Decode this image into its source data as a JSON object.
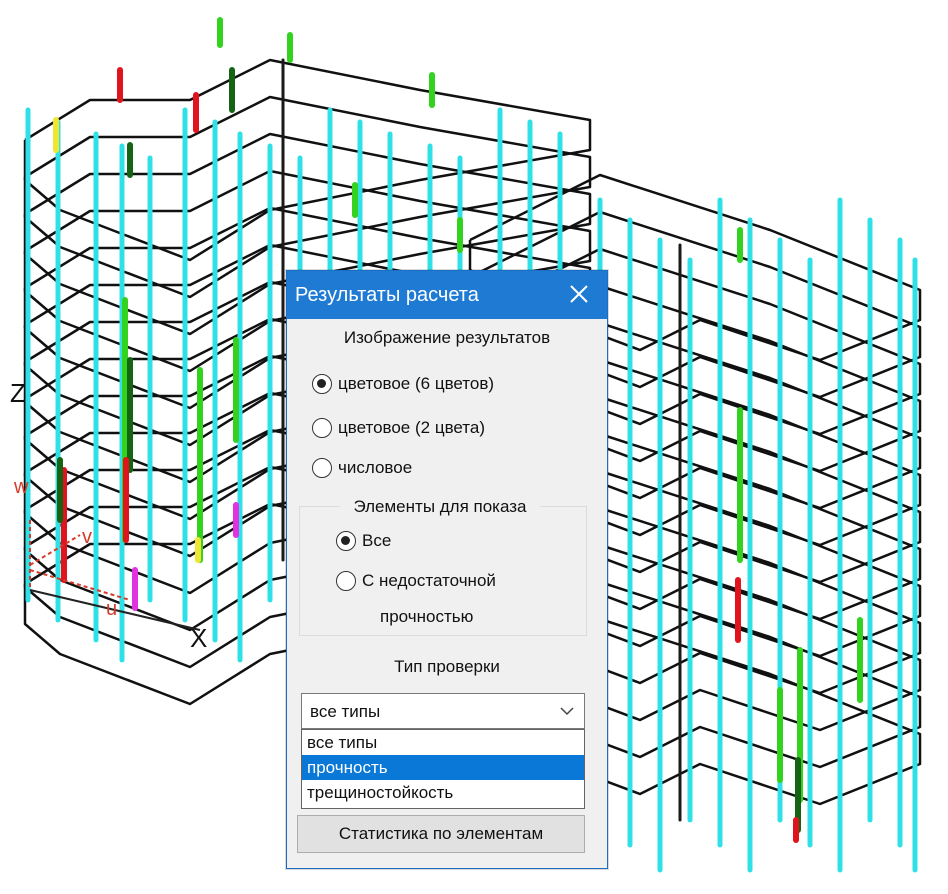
{
  "dialog": {
    "title": "Результаты расчета",
    "display_group": {
      "heading": "Изображение результатов",
      "options": [
        "цветовое (6 цветов)",
        "цветовое (2 цвета)",
        "числовое"
      ],
      "selected_index": 0
    },
    "elements_group": {
      "heading": "Элементы для показа",
      "options": [
        "Все",
        "С недостаточной",
        "прочностью"
      ],
      "selected_index": 0
    },
    "check_type": {
      "heading": "Тип проверки",
      "selected_value": "все типы",
      "options": [
        "все типы",
        "прочность",
        "трещиностойкость"
      ],
      "highlighted_index": 1
    },
    "stats_button_label": "Статистика по элементам"
  },
  "axes": {
    "x": "X",
    "z": "Z",
    "u": "u",
    "v": "v",
    "w": "w"
  },
  "colors": {
    "dialog_title_bg": "#1f7ad4",
    "highlight": "#0a78d7",
    "column_cyan": "#2fe0e6",
    "column_green": "#32d21e",
    "column_darkgreen": "#146414",
    "column_red": "#e1141e",
    "column_yellow": "#f0e632",
    "column_magenta": "#e132e1"
  }
}
